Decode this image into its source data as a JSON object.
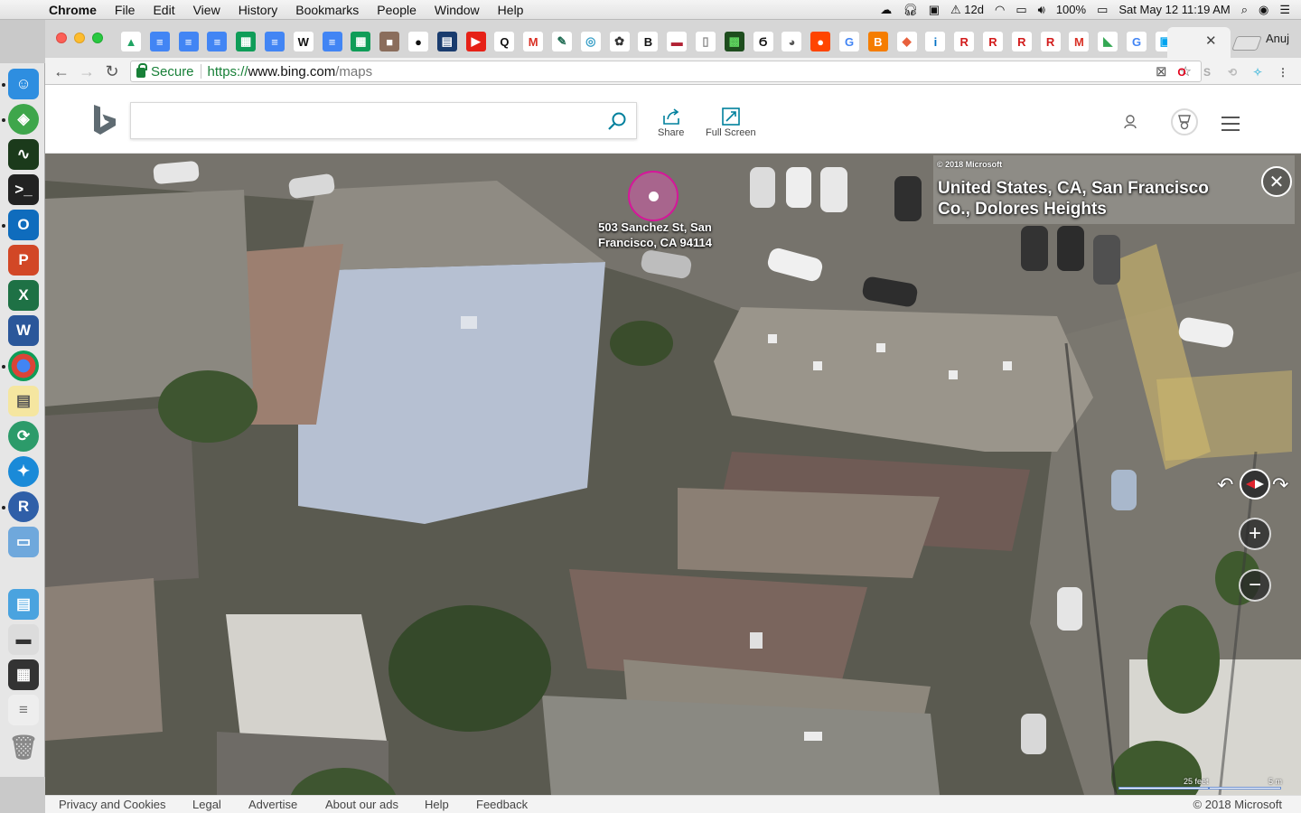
{
  "menubar": {
    "app": "Chrome",
    "items": [
      "File",
      "Edit",
      "View",
      "History",
      "Bookmarks",
      "People",
      "Window",
      "Help"
    ],
    "tray_countdown": "12d",
    "battery": "100%",
    "datetime": "Sat May 12  11:19 AM"
  },
  "browser": {
    "profile": "Anuj",
    "secure_label": "Secure",
    "url_scheme": "https://",
    "url_host": "www.bing.com",
    "url_path": "/maps",
    "pinned_tabs": [
      {
        "icon": "drive-icon",
        "glyph": "▲",
        "bg": "#ffffff",
        "fg": "#1fa463"
      },
      {
        "icon": "docs-icon",
        "glyph": "≡",
        "bg": "#4285f4",
        "fg": "#ffffff"
      },
      {
        "icon": "docs-icon",
        "glyph": "≡",
        "bg": "#4285f4",
        "fg": "#ffffff"
      },
      {
        "icon": "docs-icon",
        "glyph": "≡",
        "bg": "#4285f4",
        "fg": "#ffffff"
      },
      {
        "icon": "sheets-icon",
        "glyph": "▦",
        "bg": "#0f9d58",
        "fg": "#ffffff"
      },
      {
        "icon": "docs-icon",
        "glyph": "≡",
        "bg": "#4285f4",
        "fg": "#ffffff"
      },
      {
        "icon": "wikipedia-icon",
        "glyph": "W",
        "bg": "#ffffff",
        "fg": "#111111"
      },
      {
        "icon": "docs-icon",
        "glyph": "≡",
        "bg": "#4285f4",
        "fg": "#ffffff"
      },
      {
        "icon": "sheets-icon",
        "glyph": "▦",
        "bg": "#0f9d58",
        "fg": "#ffffff"
      },
      {
        "icon": "photo-icon",
        "glyph": "■",
        "bg": "#8a6d5c",
        "fg": "#ffffff"
      },
      {
        "icon": "github-icon",
        "glyph": "●",
        "bg": "#ffffff",
        "fg": "#111111"
      },
      {
        "icon": "keyboard-icon",
        "glyph": "▤",
        "bg": "#1a3c6e",
        "fg": "#ffffff"
      },
      {
        "icon": "youtube-icon",
        "glyph": "▶",
        "bg": "#e62117",
        "fg": "#ffffff"
      },
      {
        "icon": "quora-icon",
        "glyph": "Q",
        "bg": "#ffffff",
        "fg": "#111111"
      },
      {
        "icon": "gmail-icon",
        "glyph": "M",
        "bg": "#ffffff",
        "fg": "#d93025"
      },
      {
        "icon": "feather-icon",
        "glyph": "✎",
        "bg": "#ffffff",
        "fg": "#1f6b52"
      },
      {
        "icon": "globe-icon",
        "glyph": "◎",
        "bg": "#ffffff",
        "fg": "#3aa0c8"
      },
      {
        "icon": "octo-icon",
        "glyph": "✿",
        "bg": "#ffffff",
        "fg": "#333333"
      },
      {
        "icon": "bold-b-icon",
        "glyph": "B",
        "bg": "#ffffff",
        "fg": "#111111"
      },
      {
        "icon": "flag-icon",
        "glyph": "▬",
        "bg": "#ffffff",
        "fg": "#b22234"
      },
      {
        "icon": "page-icon",
        "glyph": "▯",
        "bg": "#ffffff",
        "fg": "#888888"
      },
      {
        "icon": "terminal-icon",
        "glyph": "▩",
        "bg": "#1e4d1e",
        "fg": "#5fd35f"
      },
      {
        "icon": "bird-icon",
        "glyph": "Ϭ",
        "bg": "#ffffff",
        "fg": "#111111"
      },
      {
        "icon": "pacman-icon",
        "glyph": "◕",
        "bg": "#ffffff",
        "fg": "#555555"
      },
      {
        "icon": "reddit-icon",
        "glyph": "●",
        "bg": "#ff4500",
        "fg": "#ffffff"
      },
      {
        "icon": "google-icon",
        "glyph": "G",
        "bg": "#ffffff",
        "fg": "#4285f4"
      },
      {
        "icon": "blogger-icon",
        "glyph": "B",
        "bg": "#f57d00",
        "fg": "#ffffff"
      },
      {
        "icon": "tag-icon",
        "glyph": "◆",
        "bg": "#ffffff",
        "fg": "#e8603c"
      },
      {
        "icon": "intel-icon",
        "glyph": "i",
        "bg": "#ffffff",
        "fg": "#0071c5"
      },
      {
        "icon": "r-icon",
        "glyph": "R",
        "bg": "#ffffff",
        "fg": "#d21c1c"
      },
      {
        "icon": "r-icon",
        "glyph": "R",
        "bg": "#ffffff",
        "fg": "#d21c1c"
      },
      {
        "icon": "r-icon",
        "glyph": "R",
        "bg": "#ffffff",
        "fg": "#d21c1c"
      },
      {
        "icon": "r-icon",
        "glyph": "R",
        "bg": "#ffffff",
        "fg": "#d21c1c"
      },
      {
        "icon": "gmail-icon",
        "glyph": "M",
        "bg": "#ffffff",
        "fg": "#d93025"
      },
      {
        "icon": "maps-icon",
        "glyph": "◣",
        "bg": "#ffffff",
        "fg": "#34a853"
      },
      {
        "icon": "google-icon",
        "glyph": "G",
        "bg": "#ffffff",
        "fg": "#4285f4"
      },
      {
        "icon": "app-icon",
        "glyph": "▣",
        "bg": "#ffffff",
        "fg": "#00a4ef"
      }
    ]
  },
  "bing": {
    "share_label": "Share",
    "fullscreen_label": "Full Screen",
    "search_value": ""
  },
  "map": {
    "copyright_overlay": "© 2018 Microsoft",
    "location_title": "United States, CA, San Francisco Co., Dolores Heights",
    "pin_label": "503 Sanchez St, San Francisco, CA 94114",
    "scale_feet": "25 feet",
    "scale_m": "5 m"
  },
  "footer": {
    "links": [
      "Privacy and Cookies",
      "Legal",
      "Advertise",
      "About our ads",
      "Help",
      "Feedback"
    ],
    "copyright": "© 2018 Microsoft"
  },
  "colors": {
    "secure_green": "#188038",
    "pin_magenta": "#d6169a",
    "bing_teal": "#00809d"
  }
}
